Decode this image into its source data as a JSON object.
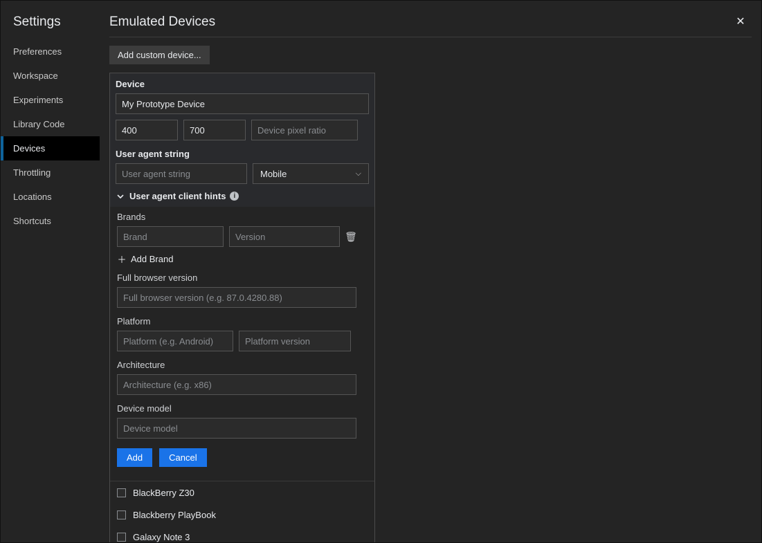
{
  "sidebar": {
    "title": "Settings",
    "items": [
      {
        "label": "Preferences"
      },
      {
        "label": "Workspace"
      },
      {
        "label": "Experiments"
      },
      {
        "label": "Library Code"
      },
      {
        "label": "Devices"
      },
      {
        "label": "Throttling"
      },
      {
        "label": "Locations"
      },
      {
        "label": "Shortcuts"
      }
    ]
  },
  "page": {
    "title": "Emulated Devices",
    "addCustom": "Add custom device..."
  },
  "editor": {
    "deviceLabel": "Device",
    "deviceName": "My Prototype Device",
    "width": "400",
    "height": "700",
    "dprPlaceholder": "Device pixel ratio",
    "uaLabel": "User agent string",
    "uaPlaceholder": "User agent string",
    "uaType": "Mobile",
    "hintsLabel": "User agent client hints",
    "brandsLabel": "Brands",
    "brandPlaceholder": "Brand",
    "versionPlaceholder": "Version",
    "addBrand": "Add Brand",
    "fullBrowserLabel": "Full browser version",
    "fullBrowserPlaceholder": "Full browser version (e.g. 87.0.4280.88)",
    "platformLabel": "Platform",
    "platformPlaceholder": "Platform (e.g. Android)",
    "platformVersionPlaceholder": "Platform version",
    "archLabel": "Architecture",
    "archPlaceholder": "Architecture (e.g. x86)",
    "deviceModelLabel": "Device model",
    "deviceModelPlaceholder": "Device model",
    "addBtn": "Add",
    "cancelBtn": "Cancel"
  },
  "deviceList": [
    {
      "label": "BlackBerry Z30"
    },
    {
      "label": "Blackberry PlayBook"
    },
    {
      "label": "Galaxy Note 3"
    }
  ]
}
